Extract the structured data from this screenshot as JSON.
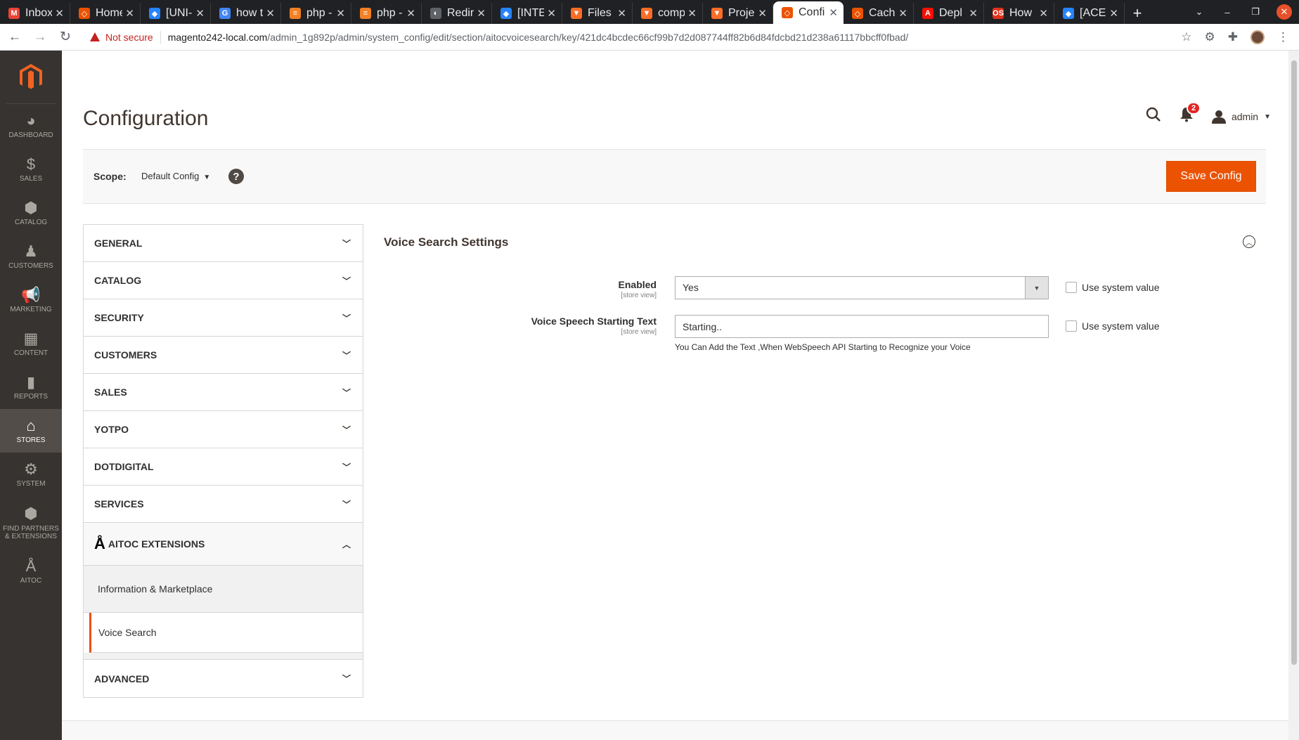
{
  "browser": {
    "tabs": [
      {
        "title": "Inbox",
        "favicon": "gmail-icon",
        "color": "#ea4335",
        "glyph": "M"
      },
      {
        "title": "Home",
        "favicon": "magento-icon",
        "color": "#eb5202",
        "glyph": "◇"
      },
      {
        "title": "[UNI-",
        "favicon": "jira-icon",
        "color": "#2684ff",
        "glyph": "◆"
      },
      {
        "title": "how t",
        "favicon": "google-icon",
        "color": "#4285f4",
        "glyph": "G"
      },
      {
        "title": "php -",
        "favicon": "stackoverflow-icon",
        "color": "#f48024",
        "glyph": "≡"
      },
      {
        "title": "php -",
        "favicon": "stackoverflow-icon",
        "color": "#f48024",
        "glyph": "≡"
      },
      {
        "title": "Redir",
        "favicon": "globe-icon",
        "color": "#5f6368",
        "glyph": "◐"
      },
      {
        "title": "[INTE",
        "favicon": "jira-icon",
        "color": "#2684ff",
        "glyph": "◆"
      },
      {
        "title": "Files",
        "favicon": "gitlab-icon",
        "color": "#fc6d26",
        "glyph": "▼"
      },
      {
        "title": "comp",
        "favicon": "gitlab-icon",
        "color": "#fc6d26",
        "glyph": "▼"
      },
      {
        "title": "Proje",
        "favicon": "gitlab-icon",
        "color": "#fc6d26",
        "glyph": "▼"
      },
      {
        "title": "Confi",
        "favicon": "magento-icon",
        "color": "#eb5202",
        "glyph": "◇",
        "active": true
      },
      {
        "title": "Cach",
        "favicon": "magento-icon",
        "color": "#eb5202",
        "glyph": "◇"
      },
      {
        "title": "Depl",
        "favicon": "adobe-icon",
        "color": "#fa0f00",
        "glyph": "A"
      },
      {
        "title": "How",
        "favicon": "os-icon",
        "color": "#e0321a",
        "glyph": "OS"
      },
      {
        "title": "[ACE",
        "favicon": "jira-icon",
        "color": "#2684ff",
        "glyph": "◆"
      }
    ],
    "new_tab": "+",
    "not_secure": "Not secure",
    "url_host": "magento242-local.com",
    "url_path": "/admin_1g892p/admin/system_config/edit/section/aitocvoicesearch/key/421dc4bcdec66cf99b7d2d087744ff82b6d84fdcbd21d238a61117bbcff0fbad/"
  },
  "sidebar": {
    "items": [
      {
        "label": "DASHBOARD",
        "icon": "dashboard-icon",
        "glyph": "◕"
      },
      {
        "label": "SALES",
        "icon": "dollar-icon",
        "glyph": "$"
      },
      {
        "label": "CATALOG",
        "icon": "box-icon",
        "glyph": "⬢"
      },
      {
        "label": "CUSTOMERS",
        "icon": "person-icon",
        "glyph": "♟"
      },
      {
        "label": "MARKETING",
        "icon": "megaphone-icon",
        "glyph": "📢"
      },
      {
        "label": "CONTENT",
        "icon": "layout-icon",
        "glyph": "▦"
      },
      {
        "label": "REPORTS",
        "icon": "bar-chart-icon",
        "glyph": "▮"
      },
      {
        "label": "STORES",
        "icon": "store-icon",
        "glyph": "⌂",
        "active": true
      },
      {
        "label": "SYSTEM",
        "icon": "gear-icon",
        "glyph": "⚙"
      },
      {
        "label": "FIND PARTNERS & EXTENSIONS",
        "icon": "extensions-icon",
        "glyph": "⬢"
      },
      {
        "label": "AITOC",
        "icon": "aitoc-icon",
        "glyph": "Å"
      }
    ]
  },
  "header": {
    "page_title": "Configuration",
    "notifications_count": "2",
    "admin_user": "admin"
  },
  "scope": {
    "label": "Scope:",
    "value": "Default Config",
    "help": "?"
  },
  "actions": {
    "save_label": "Save Config"
  },
  "config_nav": {
    "sections": [
      "GENERAL",
      "CATALOG",
      "SECURITY",
      "CUSTOMERS",
      "SALES",
      "YOTPO",
      "DOTDIGITAL",
      "SERVICES"
    ],
    "aitoc_label": "AITOC EXTENSIONS",
    "aitoc_items": [
      "Information & Marketplace",
      "Voice Search"
    ],
    "advanced_label": "ADVANCED"
  },
  "section": {
    "title": "Voice Search Settings",
    "fields": [
      {
        "label": "Enabled",
        "scope": "[store view]",
        "value": "Yes",
        "system_value_label": "Use system value"
      },
      {
        "label": "Voice Speech Starting Text",
        "scope": "[store view]",
        "value": "Starting..",
        "system_value_label": "Use system value",
        "note": "You Can Add the Text ,When WebSpeech API Starting to Recognize your Voice"
      }
    ]
  },
  "colors": {
    "accent": "#eb5202",
    "sidebar_bg": "#373330",
    "sidebar_active": "#524d49"
  }
}
